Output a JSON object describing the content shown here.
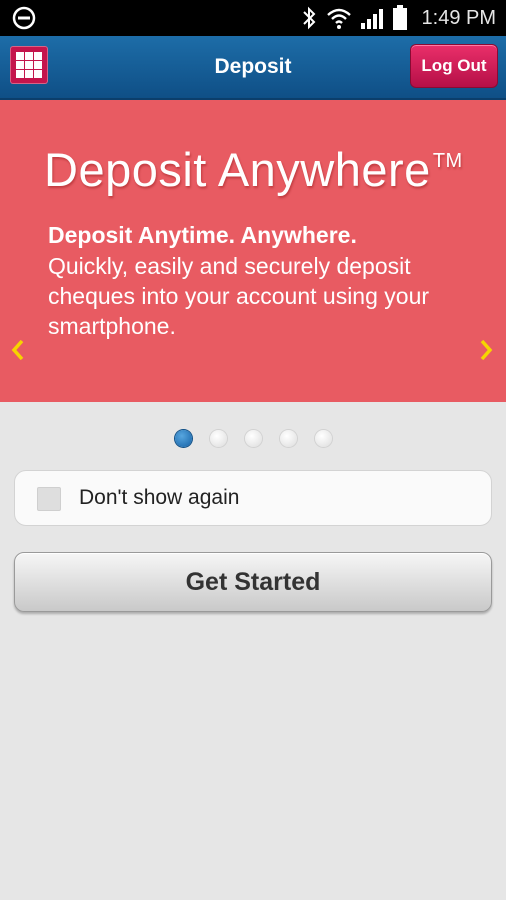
{
  "status_bar": {
    "time": "1:49 PM",
    "icons": [
      "dnd-icon",
      "bluetooth-icon",
      "wifi-icon",
      "signal-icon",
      "battery-icon"
    ]
  },
  "app_bar": {
    "title": "Deposit",
    "logout_label": "Log Out",
    "menu_icon": "grid-menu-icon"
  },
  "banner": {
    "title": "Deposit Anywhere",
    "trademark": "TM",
    "heading": "Deposit Anytime. Anywhere.",
    "body": "Quickly, easily and securely deposit cheques into your account using your smartphone.",
    "background_color": "#e85b62",
    "arrow_color": "#f6d400"
  },
  "pager": {
    "pages": 5,
    "active_index": 0
  },
  "checkbox": {
    "label": "Don't show again",
    "checked": false
  },
  "cta": {
    "label": "Get Started"
  },
  "colors": {
    "app_bar": "#1d6da8",
    "logout": "#d41c59",
    "menu": "#c4154c",
    "background": "#e6e6e6"
  }
}
